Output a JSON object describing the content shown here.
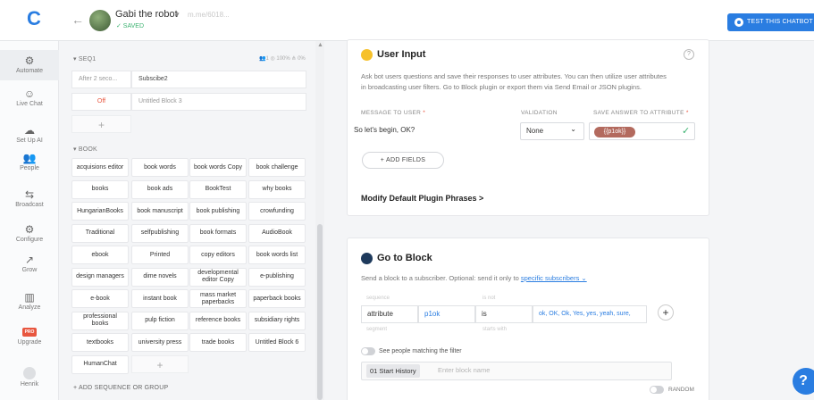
{
  "topbar": {
    "logo": "C",
    "back_icon": "←",
    "bot_name": "Gabi the robot",
    "bot_chevron": "▾",
    "bot_url": "m.me/6018...",
    "saved": "✓ SAVED",
    "test_button": "TEST THIS CHATBOT"
  },
  "nav": [
    {
      "label": "Automate",
      "icon": "⚙"
    },
    {
      "label": "Live Chat",
      "icon": "☺"
    },
    {
      "label": "Set Up AI",
      "icon": "☁"
    },
    {
      "label": "People",
      "icon": "👥"
    },
    {
      "label": "Broadcast",
      "icon": "⇆"
    },
    {
      "label": "Configure",
      "icon": "⚙"
    },
    {
      "label": "Grow",
      "icon": "↗"
    },
    {
      "label": "Analyze",
      "icon": "▥"
    },
    {
      "label": "Upgrade",
      "pro": "PRO"
    },
    {
      "label": "Henrik"
    }
  ],
  "sequence": {
    "header": "▾ SEQ1",
    "stats": "👥1 ◎ 100% ⋔ 0%",
    "rows": [
      {
        "left": "After 2 seco...",
        "right": "Subscibe2"
      },
      {
        "left": "Off",
        "right": "Untitled Block 3"
      }
    ],
    "plus": "+"
  },
  "book_group": {
    "header": "▾ BOOK",
    "blocks": [
      "acquisions editor",
      "book words",
      "book words Copy",
      "book challenge",
      "books",
      "book ads",
      "BookTest",
      "why books",
      "HungarianBooks",
      "book manuscript",
      "book publishing",
      "crowfunding",
      "Traditional",
      "selfpublishing",
      "book formats",
      "AudioBook",
      "ebook",
      "Printed",
      "copy editors",
      "book words list",
      "design managers",
      "dime novels",
      "developmental editor Copy",
      "e-publishing",
      "e-book",
      "instant book",
      "mass market paperbacks",
      "paperback books",
      "professional books",
      "pulp fiction",
      "reference books",
      "subsidiary rights",
      "textbooks",
      "university press",
      "trade books",
      "Untitled Block 6",
      "HumanChat"
    ],
    "plus": "+"
  },
  "add_sequence": "+ ADD SEQUENCE OR GROUP",
  "user_input": {
    "title": "User Input",
    "help": "?",
    "description_1": "Ask bot users questions and save their responses to user attributes. You can then utilize user attributes",
    "description_2": "in broadcasting user filters. Go to Block plugin or export them via Send Email or JSON plugins.",
    "message_label": "MESSAGE TO USER",
    "validation_label": "VALIDATION",
    "save_label": "SAVE ANSWER TO ATTRIBUTE",
    "required_mark": "*",
    "message_value": "So let's begin, OK?",
    "validation_value": "None",
    "validation_chevron": "⌄",
    "attribute_value": "{{p1ok}}",
    "check": "✓",
    "add_fields": "+ ADD FIELDS",
    "modify_phrases": "Modify Default Plugin Phrases >"
  },
  "go_to_block": {
    "title": "Go to Block",
    "description": "Send a block to a subscriber. Optional: send it only to",
    "link": "specific subscribers ⌄",
    "faint_sequence": "sequence",
    "faint_is_not": "is not",
    "faint_segment": "segment",
    "faint_starts_with": "starts with",
    "filter": {
      "field": "attribute",
      "name": "p1ok",
      "operator": "is",
      "value": "ok, OK, Ok, Yes, yes, yeah, sure,"
    },
    "plus": "+",
    "see_people": "See people matching the filter",
    "block_chip": "01 Start History",
    "block_placeholder": "Enter block name",
    "random": "RANDOM"
  },
  "help_fab": "?"
}
